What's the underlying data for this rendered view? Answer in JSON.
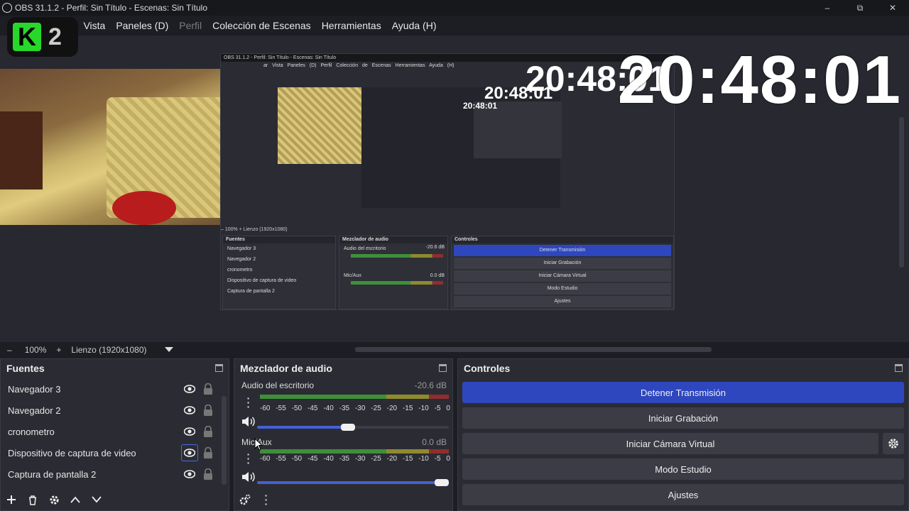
{
  "window": {
    "title": "OBS 31.1.2 - Perfil: Sin Título - Escenas: Sin Título",
    "minimize": "–",
    "maximize": "⧉",
    "close": "✕"
  },
  "menu": {
    "items": [
      {
        "label": "ar",
        "disabled": false
      },
      {
        "label": "Vista",
        "disabled": false
      },
      {
        "label": "Paneles (D)",
        "disabled": false
      },
      {
        "label": "Perfil",
        "disabled": true
      },
      {
        "label": "Colección de Escenas",
        "disabled": false
      },
      {
        "label": "Herramientas",
        "disabled": false
      },
      {
        "label": "Ayuda (H)",
        "disabled": false
      }
    ]
  },
  "overlay": {
    "logo_k": "K",
    "logo_2": "2",
    "clock": "20:48:01"
  },
  "nested": {
    "title": "OBS 31.1.2 - Perfil: Sin Título - Escenas: Sin Título",
    "menu": "ar Vista Paneles (D) Perfil Colección de Escenas Herramientas Ayuda (H)",
    "zoom_text": "– 100% + Lienzo (1920x1080)",
    "sources_title": "Fuentes",
    "mixer_title": "Mezclador de audio",
    "controls_title": "Controles",
    "sources": [
      "Navegador 3",
      "Navegador 2",
      "cronometro",
      "Dispositivo de captura de video",
      "Captura de pantalla 2"
    ],
    "channel1": "Audio del escritorio",
    "channel1_db": "-20.6 dB",
    "channel2": "Mic/Aux",
    "channel2_db": "0.0 dB",
    "buttons": [
      "Detener Transmisión",
      "Iniciar Grabación",
      "Iniciar Cámara Virtual",
      "Modo Estudio",
      "Ajustes"
    ]
  },
  "canvas": {
    "zoom_minus": "–",
    "zoom": "100%",
    "zoom_plus": "+",
    "canvas_label": "Lienzo (1920x1080)"
  },
  "sources_dock": {
    "title": "Fuentes",
    "items": [
      {
        "label": "Navegador 3",
        "selected": false
      },
      {
        "label": "Navegador 2",
        "selected": false
      },
      {
        "label": "cronometro",
        "selected": false
      },
      {
        "label": "Dispositivo de captura de video",
        "selected": true
      },
      {
        "label": "Captura de pantalla 2",
        "selected": false
      }
    ]
  },
  "mixer_dock": {
    "title": "Mezclador de audio",
    "ticks": [
      "-60",
      "-55",
      "-50",
      "-45",
      "-40",
      "-35",
      "-30",
      "-25",
      "-20",
      "-15",
      "-10",
      "-5",
      "0"
    ],
    "channels": [
      {
        "name": "Audio del escritorio",
        "db": "-20.6 dB",
        "volume": 0.47
      },
      {
        "name": "Mic/Aux",
        "db": "0.0 dB",
        "volume": 1.0
      }
    ]
  },
  "controls_dock": {
    "title": "Controles",
    "stop_stream": "Detener Transmisión",
    "start_recording": "Iniciar Grabación",
    "start_virtual_cam": "Iniciar Cámara Virtual",
    "studio_mode": "Modo Estudio",
    "settings": "Ajustes"
  },
  "colors": {
    "accent": "#2e47bf",
    "meter_green": "#3f8f3a",
    "meter_yellow": "#8f8a2e",
    "meter_red": "#8f2e2e"
  }
}
